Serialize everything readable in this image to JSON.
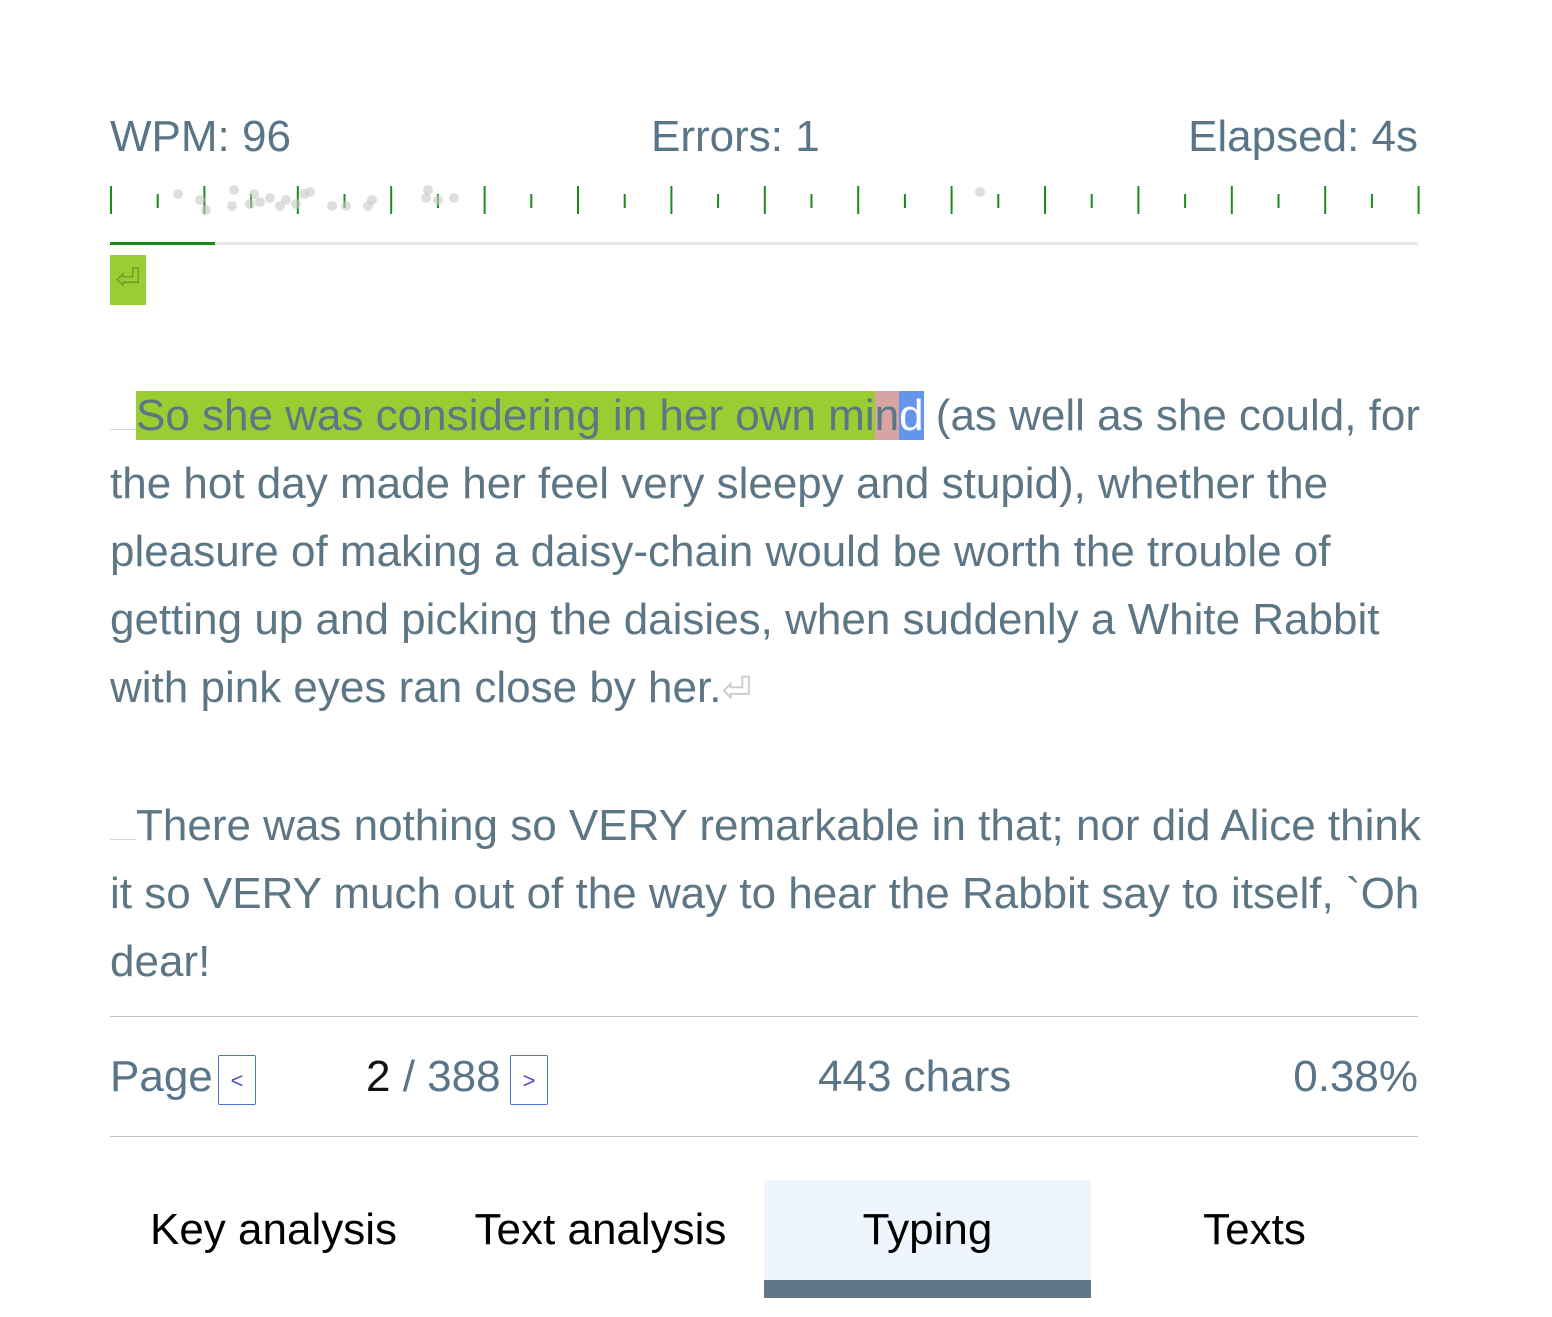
{
  "stats": {
    "wpm": "WPM: 96",
    "errors": "Errors: 1",
    "elapsed": "Elapsed: 4s"
  },
  "progress": {
    "fraction": 0.08
  },
  "colors": {
    "typed": "#9acd32",
    "error": "#d8a3a3",
    "cursor": "#6495ed",
    "text": "#5d7685",
    "tab_active_bar": "#5f7789",
    "progress": "#1a8a1a"
  },
  "enter_key": {
    "icon": "return-arrow-icon",
    "glyph": "⏎"
  },
  "text": {
    "p1": {
      "typed": "So she was considering in her own mi",
      "error": "n",
      "cursor": "d",
      "rest": " (as well as she could, for the hot day made her feel very sleepy and stupid), whether the pleasure of making a daisy-chain would be worth the trouble of getting up and picking the daisies, when suddenly a White Rabbit with pink eyes ran close by her.",
      "eol": "⏎"
    },
    "p2": {
      "rest": "There was nothing so VERY remarkable in that; nor did Alice think it so VERY much out of the way to hear the Rabbit say to itself, `Oh dear!"
    }
  },
  "pager": {
    "label": "Page",
    "prev": "<",
    "current": "2",
    "total": " / 388",
    "next": ">",
    "chars": "443 chars",
    "percent": "0.38%"
  },
  "tabs": [
    {
      "label": "Key analysis"
    },
    {
      "label": "Text analysis"
    },
    {
      "label": "Typing",
      "active": true
    },
    {
      "label": "Texts"
    }
  ]
}
